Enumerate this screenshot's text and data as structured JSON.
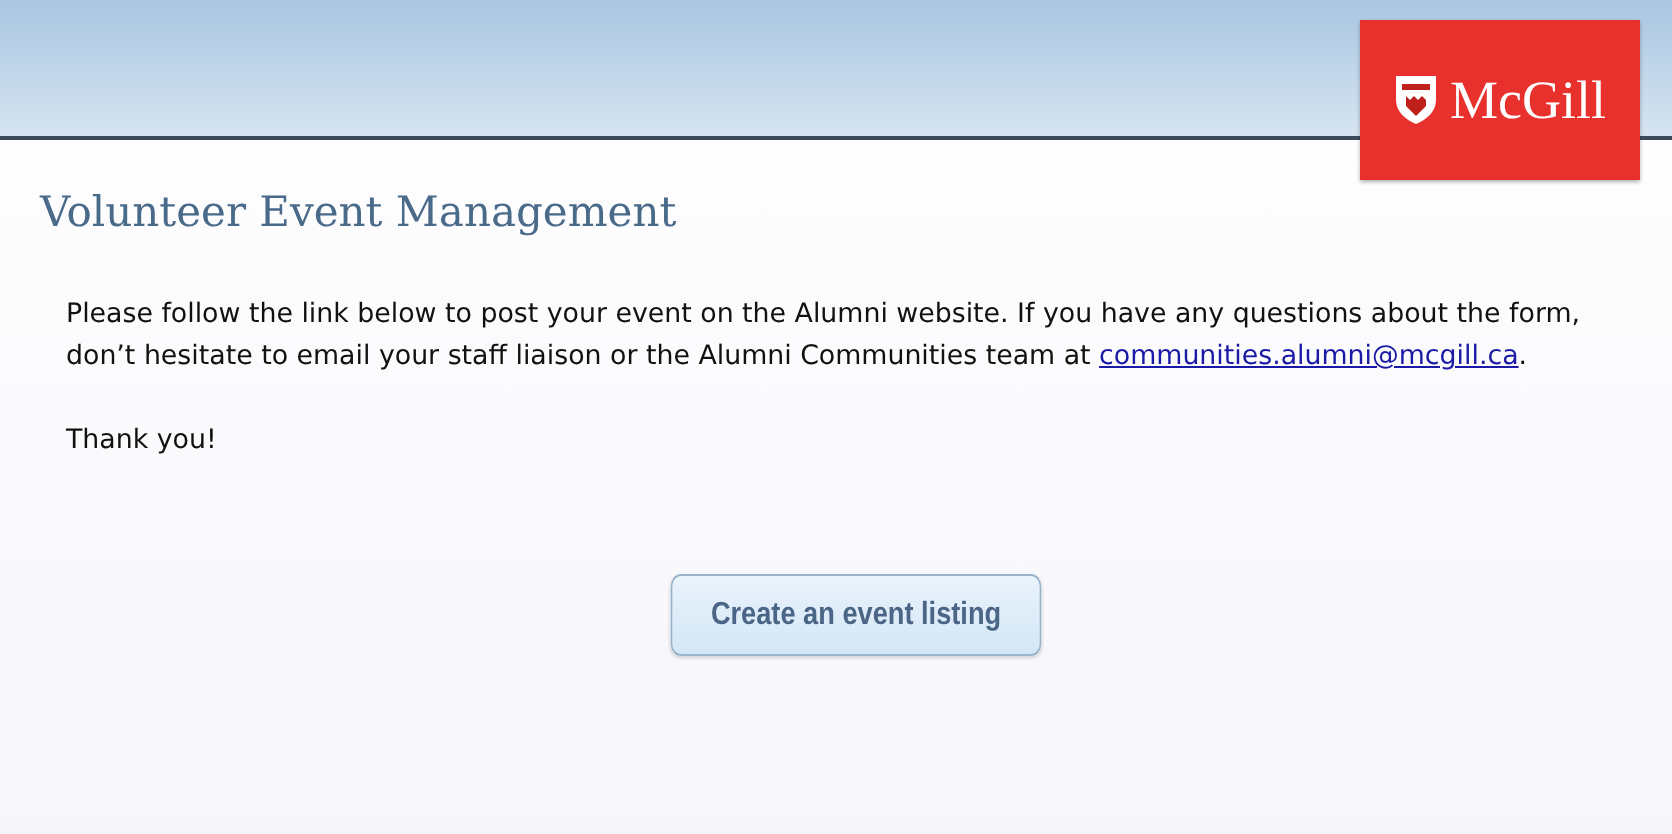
{
  "header": {
    "logo_text": "McGill"
  },
  "title": "Volunteer Event Management",
  "intro": {
    "before": "Please follow the link below to post your event on the Alumni website. If you have any questions about the form, don’t hesitate to email your staff liaison or the Alumni Communities team at ",
    "link": "communities.alumni@mcgill.ca",
    "after": "."
  },
  "thanks": "Thank you!",
  "button": {
    "label": "Create an event listing"
  }
}
